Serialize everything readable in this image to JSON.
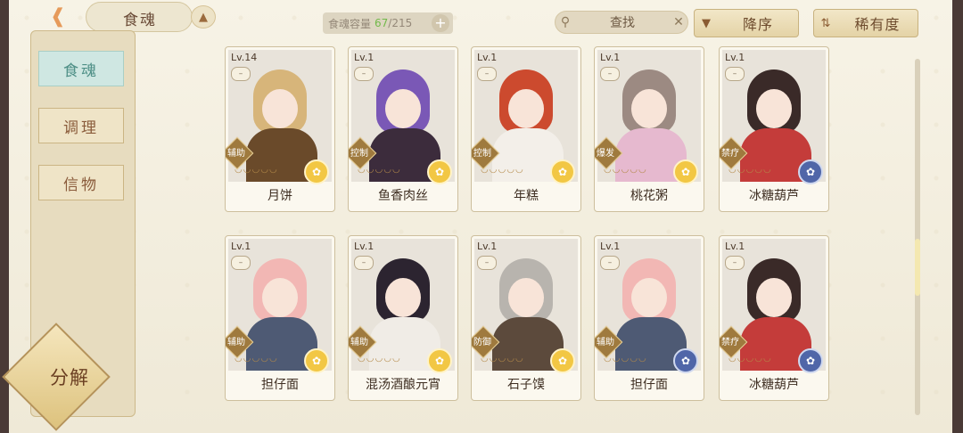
{
  "header": {
    "title": "食魂",
    "back_icon": "back-arrow-icon",
    "home_icon": "home-icon"
  },
  "capacity": {
    "label": "食魂容量",
    "used": "67",
    "total": "/215"
  },
  "search": {
    "label": "查找"
  },
  "sort": {
    "order_label": "降序",
    "field_label": "稀有度"
  },
  "sidebar": {
    "items": [
      {
        "label": "食魂",
        "active": true
      },
      {
        "label": "调理",
        "active": false
      },
      {
        "label": "信物",
        "active": false
      }
    ],
    "decompose_label": "分解"
  },
  "cards": [
    {
      "lv": "Lv.14",
      "role": "辅助",
      "name": "月饼",
      "element": "gold",
      "hair": "#d7b57a",
      "body": "#6a4a2a",
      "stars": 5
    },
    {
      "lv": "Lv.1",
      "role": "控制",
      "name": "鱼香肉丝",
      "element": "gold",
      "hair": "#7a58b6",
      "body": "#3c2c3c",
      "stars": 5
    },
    {
      "lv": "Lv.1",
      "role": "控制",
      "name": "年糕",
      "element": "gold",
      "hair": "#cc4a2e",
      "body": "#f3efe9",
      "stars": 5
    },
    {
      "lv": "Lv.1",
      "role": "爆发",
      "name": "桃花粥",
      "element": "gold",
      "hair": "#9c8a82",
      "body": "#e6b9cf",
      "stars": 5
    },
    {
      "lv": "Lv.1",
      "role": "禁疗",
      "name": "冰糖葫芦",
      "element": "blue",
      "hair": "#3a2a28",
      "body": "#c43c3a",
      "stars": 5
    },
    {
      "lv": "Lv.1",
      "role": "辅助",
      "name": "担仔面",
      "element": "gold",
      "hair": "#f2b7b4",
      "body": "#4e5a74",
      "stars": 5
    },
    {
      "lv": "Lv.1",
      "role": "辅助",
      "name": "混汤酒酿元宵",
      "element": "gold",
      "hair": "#2c2430",
      "body": "#f0ece6",
      "stars": 5
    },
    {
      "lv": "Lv.1",
      "role": "防御",
      "name": "石子馍",
      "element": "gold",
      "hair": "#b8b4ae",
      "body": "#5c4a3c",
      "stars": 5
    },
    {
      "lv": "Lv.1",
      "role": "辅助",
      "name": "担仔面",
      "element": "blue",
      "hair": "#f2b7b4",
      "body": "#4e5a74",
      "stars": 5
    },
    {
      "lv": "Lv.1",
      "role": "禁疗",
      "name": "冰糖葫芦",
      "element": "blue",
      "hair": "#3a2a28",
      "body": "#c43c3a",
      "stars": 5
    }
  ],
  "colors": {
    "accent": "#e69a5a",
    "gold_element": "#f2c744",
    "blue_element": "#5066a8",
    "active_tab": "#cfe7e2"
  }
}
